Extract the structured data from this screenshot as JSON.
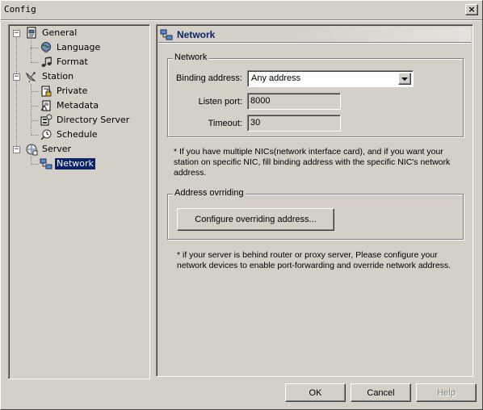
{
  "window": {
    "title": "Config",
    "close_label": "×"
  },
  "tree": {
    "items": [
      {
        "label": "General",
        "icon": "computer-doc-icon",
        "level": 0,
        "expander": "−"
      },
      {
        "label": "Language",
        "icon": "globe-icon",
        "level": 1
      },
      {
        "label": "Format",
        "icon": "music-note-icon",
        "level": 1
      },
      {
        "label": "Station",
        "icon": "satellite-dish-icon",
        "level": 0,
        "expander": "−"
      },
      {
        "label": "Private",
        "icon": "lock-doc-icon",
        "level": 1
      },
      {
        "label": "Metadata",
        "icon": "metadata-doc-icon",
        "level": 1
      },
      {
        "label": "Directory Server",
        "icon": "directory-server-icon",
        "level": 1
      },
      {
        "label": "Schedule",
        "icon": "clock-icon",
        "level": 1
      },
      {
        "label": "Server",
        "icon": "server-icon",
        "level": 0,
        "expander": "−"
      },
      {
        "label": "Network",
        "icon": "network-icon",
        "level": 1,
        "selected": true
      }
    ]
  },
  "content": {
    "header_title": "Network",
    "network_group": {
      "title": "Network",
      "binding_label": "Binding address:",
      "binding_value": "Any address",
      "listen_port_label": "Listen port:",
      "listen_port_value": "8000",
      "timeout_label": "Timeout:",
      "timeout_value": "30"
    },
    "nic_note_lines": [
      "* If you have multiple NICs(network interface card), and if you want your",
      "station on specific NIC, fill binding address with the specific NIC's network",
      "address."
    ],
    "override_group": {
      "title": "Address ovrriding",
      "button_label": "Configure overriding address..."
    },
    "router_note_lines": [
      "* if your server is behind router or proxy server,  Please configure your",
      "network devices to enable port-forwarding and override network address."
    ]
  },
  "footer": {
    "ok_label": "OK",
    "cancel_label": "Cancel",
    "help_label": "Help"
  },
  "colors": {
    "face": "#d4d0c8",
    "selection": "#0a246a",
    "header_text": "#0a246a"
  }
}
